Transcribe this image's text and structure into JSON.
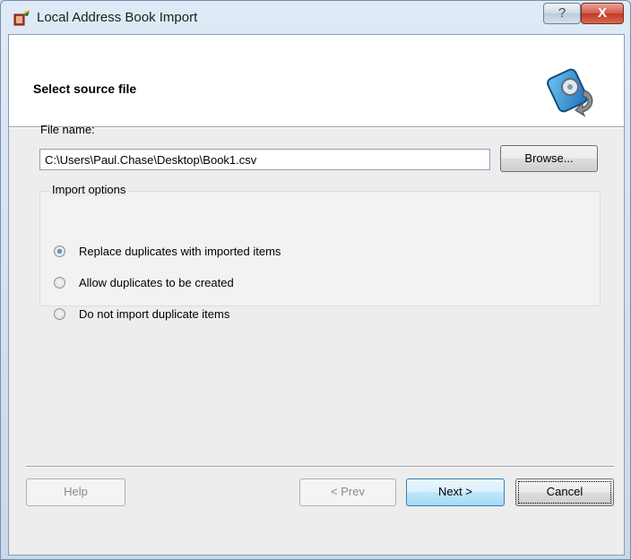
{
  "window": {
    "title": "Local Address Book Import",
    "help_glyph": "?",
    "close_glyph": "X"
  },
  "header": {
    "title": "Select source file",
    "icon": "address-book-import-icon"
  },
  "file": {
    "label": "File name:",
    "value": "C:\\Users\\Paul.Chase\\Desktop\\Book1.csv",
    "browse_label": "Browse..."
  },
  "import_options": {
    "title": "Import options",
    "options": [
      {
        "label": "Replace duplicates with imported items",
        "checked": true
      },
      {
        "label": "Allow duplicates to be created",
        "checked": false
      },
      {
        "label": "Do not import duplicate items",
        "checked": false
      }
    ]
  },
  "footer": {
    "help_label": "Help",
    "prev_label": "< Prev",
    "next_label": "Next >",
    "cancel_label": "Cancel"
  },
  "colors": {
    "accent": "#1c5f9a",
    "close": "#c03a2a"
  }
}
